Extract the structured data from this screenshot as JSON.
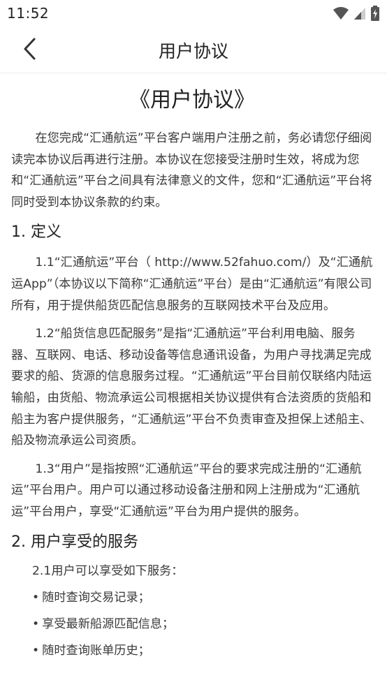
{
  "status_bar": {
    "time": "11:52"
  },
  "nav": {
    "title": "用户协议"
  },
  "document": {
    "title": "《用户协议》",
    "intro": "在您完成“汇通航运”平台客户端用户注册之前，务必请您仔细阅读完本协议后再进行注册。本协议在您接受注册时生效，将成为您和“汇通航运”平台之间具有法律意义的文件，您和“汇通航运”平台将同时受到本协议条款的约束。",
    "section1": {
      "heading": "1. 定义",
      "p1": "1.1“汇通航运”平台（ http://www.52fahuo.com/）及“汇通航运App”（本协议以下简称“汇通航运”平台）是由“汇通航运”有限公司所有，用于提供船货匹配信息服务的互联网技术平台及应用。",
      "p2": "1.2“船货信息匹配服务”是指“汇通航运”平台利用电脑、服务器、互联网、电话、移动设备等信息通讯设备，为用户寻找满足完成要求的船、货源的信息服务过程。“汇通航运”平台目前仅联络内陆运输船，由货船、物流承运公司根据相关协议提供有合法资质的货船和船主为客户提供服务，“汇通航运”平台不负责审查及担保上述船主、船及物流承运公司资质。",
      "p3": "1.3“用户”是指按照“汇通航运”平台的要求完成注册的“汇通航运”平台用户。用户可以通过移动设备注册和网上注册成为“汇通航运”平台用户，享受“汇通航运”平台为用户提供的服务。"
    },
    "section2": {
      "heading": "2. 用户享受的服务",
      "intro": "2.1用户可以享受如下服务：",
      "items": [
        "随时查询交易记录；",
        "享受最新船源匹配信息；",
        "随时查询账单历史；"
      ]
    }
  },
  "icons": {
    "back": "chevron-left-icon",
    "wifi": "wifi-icon",
    "signal": "cell-signal-icon",
    "battery": "battery-charging-icon"
  },
  "colors": {
    "text": "#3a3a3a",
    "title": "#222222",
    "status_icon": "#555555"
  }
}
